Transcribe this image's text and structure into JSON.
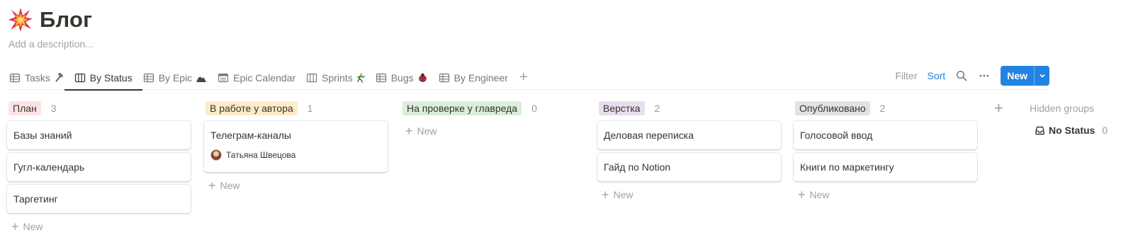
{
  "page": {
    "title": "Блог",
    "description_placeholder": "Add a description...",
    "icon": "collision-emoji-icon"
  },
  "views": [
    {
      "label": "Tasks",
      "icon": "table-icon",
      "emoji": "hammer"
    },
    {
      "label": "By Status",
      "icon": "board-icon",
      "active": true
    },
    {
      "label": "By Epic",
      "icon": "table-icon",
      "emoji": "mountain"
    },
    {
      "label": "Epic Calendar",
      "icon": "calendar-icon"
    },
    {
      "label": "Sprints",
      "icon": "board-icon",
      "emoji": "runner"
    },
    {
      "label": "Bugs",
      "icon": "table-icon",
      "emoji": "ladybug"
    },
    {
      "label": "By Engineer",
      "icon": "table-icon"
    }
  ],
  "toolbar": {
    "filter_label": "Filter",
    "sort_label": "Sort",
    "new_label": "New"
  },
  "columns": [
    {
      "name": "План",
      "count": "3",
      "color": "#fbe4e4",
      "cards": [
        {
          "title": "Базы знаний"
        },
        {
          "title": "Гугл-календарь"
        },
        {
          "title": "Таргетинг"
        }
      ]
    },
    {
      "name": "В работе у автора",
      "count": "1",
      "color": "#fdecc8",
      "cards": [
        {
          "title": "Телеграм-каналы",
          "person": "Татьяна Швецова"
        }
      ]
    },
    {
      "name": "На проверке у главреда",
      "count": "0",
      "color": "#dbeddb",
      "cards": []
    },
    {
      "name": "Верстка",
      "count": "2",
      "color": "#e8deee",
      "cards": [
        {
          "title": "Деловая переписка"
        },
        {
          "title": "Гайд по Notion"
        }
      ]
    },
    {
      "name": "Опубликовано",
      "count": "2",
      "color": "#e3e2e0",
      "cards": [
        {
          "title": "Голосовой ввод"
        },
        {
          "title": "Книги по маркетингу"
        }
      ]
    }
  ],
  "new_card_label": "New",
  "hidden_groups": {
    "label": "Hidden groups",
    "items": [
      {
        "name": "No Status",
        "count": "0"
      }
    ]
  }
}
